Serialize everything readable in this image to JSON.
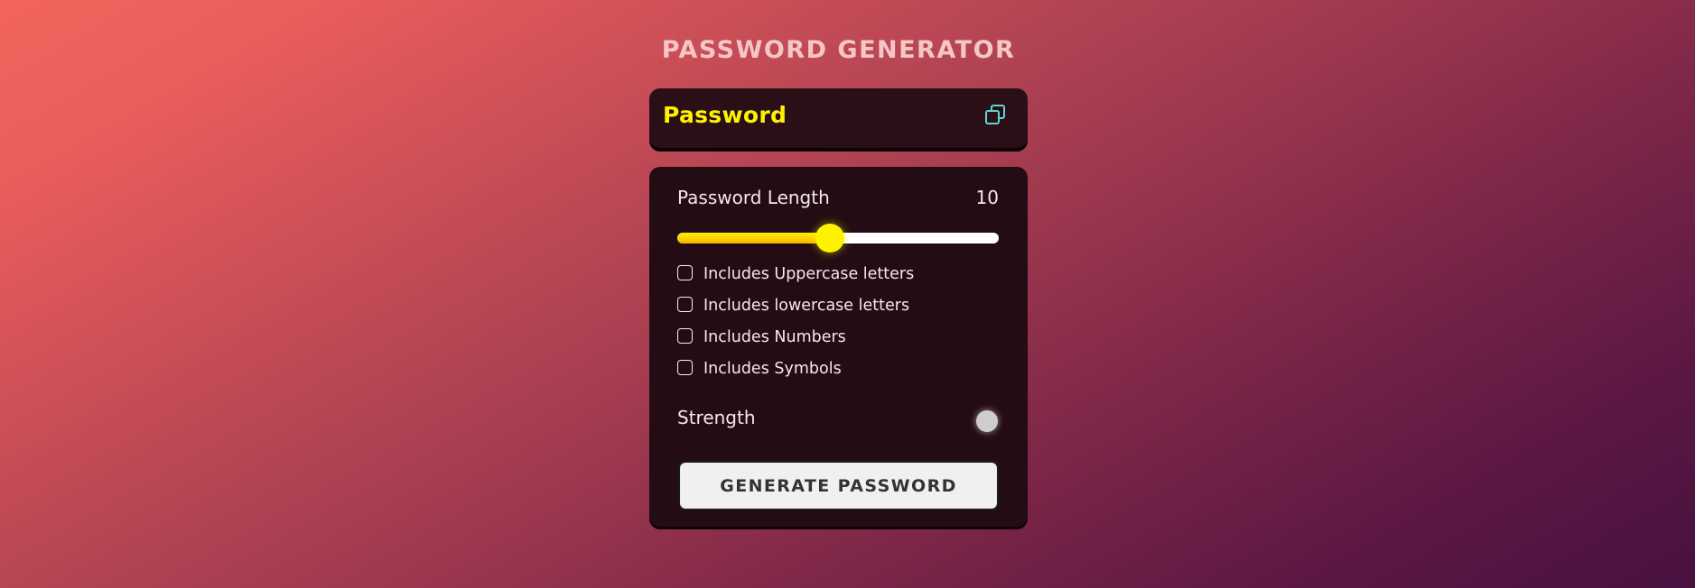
{
  "app": {
    "title": "PASSWORD GENERATOR"
  },
  "display": {
    "password_text": "Password",
    "copy_icon": "copy-icon"
  },
  "length": {
    "label": "Password Length",
    "value": "10",
    "slider_fraction": 0.474
  },
  "options": [
    {
      "label": "Includes Uppercase letters",
      "checked": false
    },
    {
      "label": "Includes lowercase letters",
      "checked": false
    },
    {
      "label": "Includes Numbers",
      "checked": false
    },
    {
      "label": "Includes Symbols",
      "checked": false
    }
  ],
  "strength": {
    "label": "Strength",
    "indicator_color": "#cdcdcd"
  },
  "generate_button": {
    "label": "GENERATE PASSWORD"
  },
  "colors": {
    "accent": "#fff200",
    "copy_icon": "#5fd6d3",
    "panel": "#230c13"
  }
}
